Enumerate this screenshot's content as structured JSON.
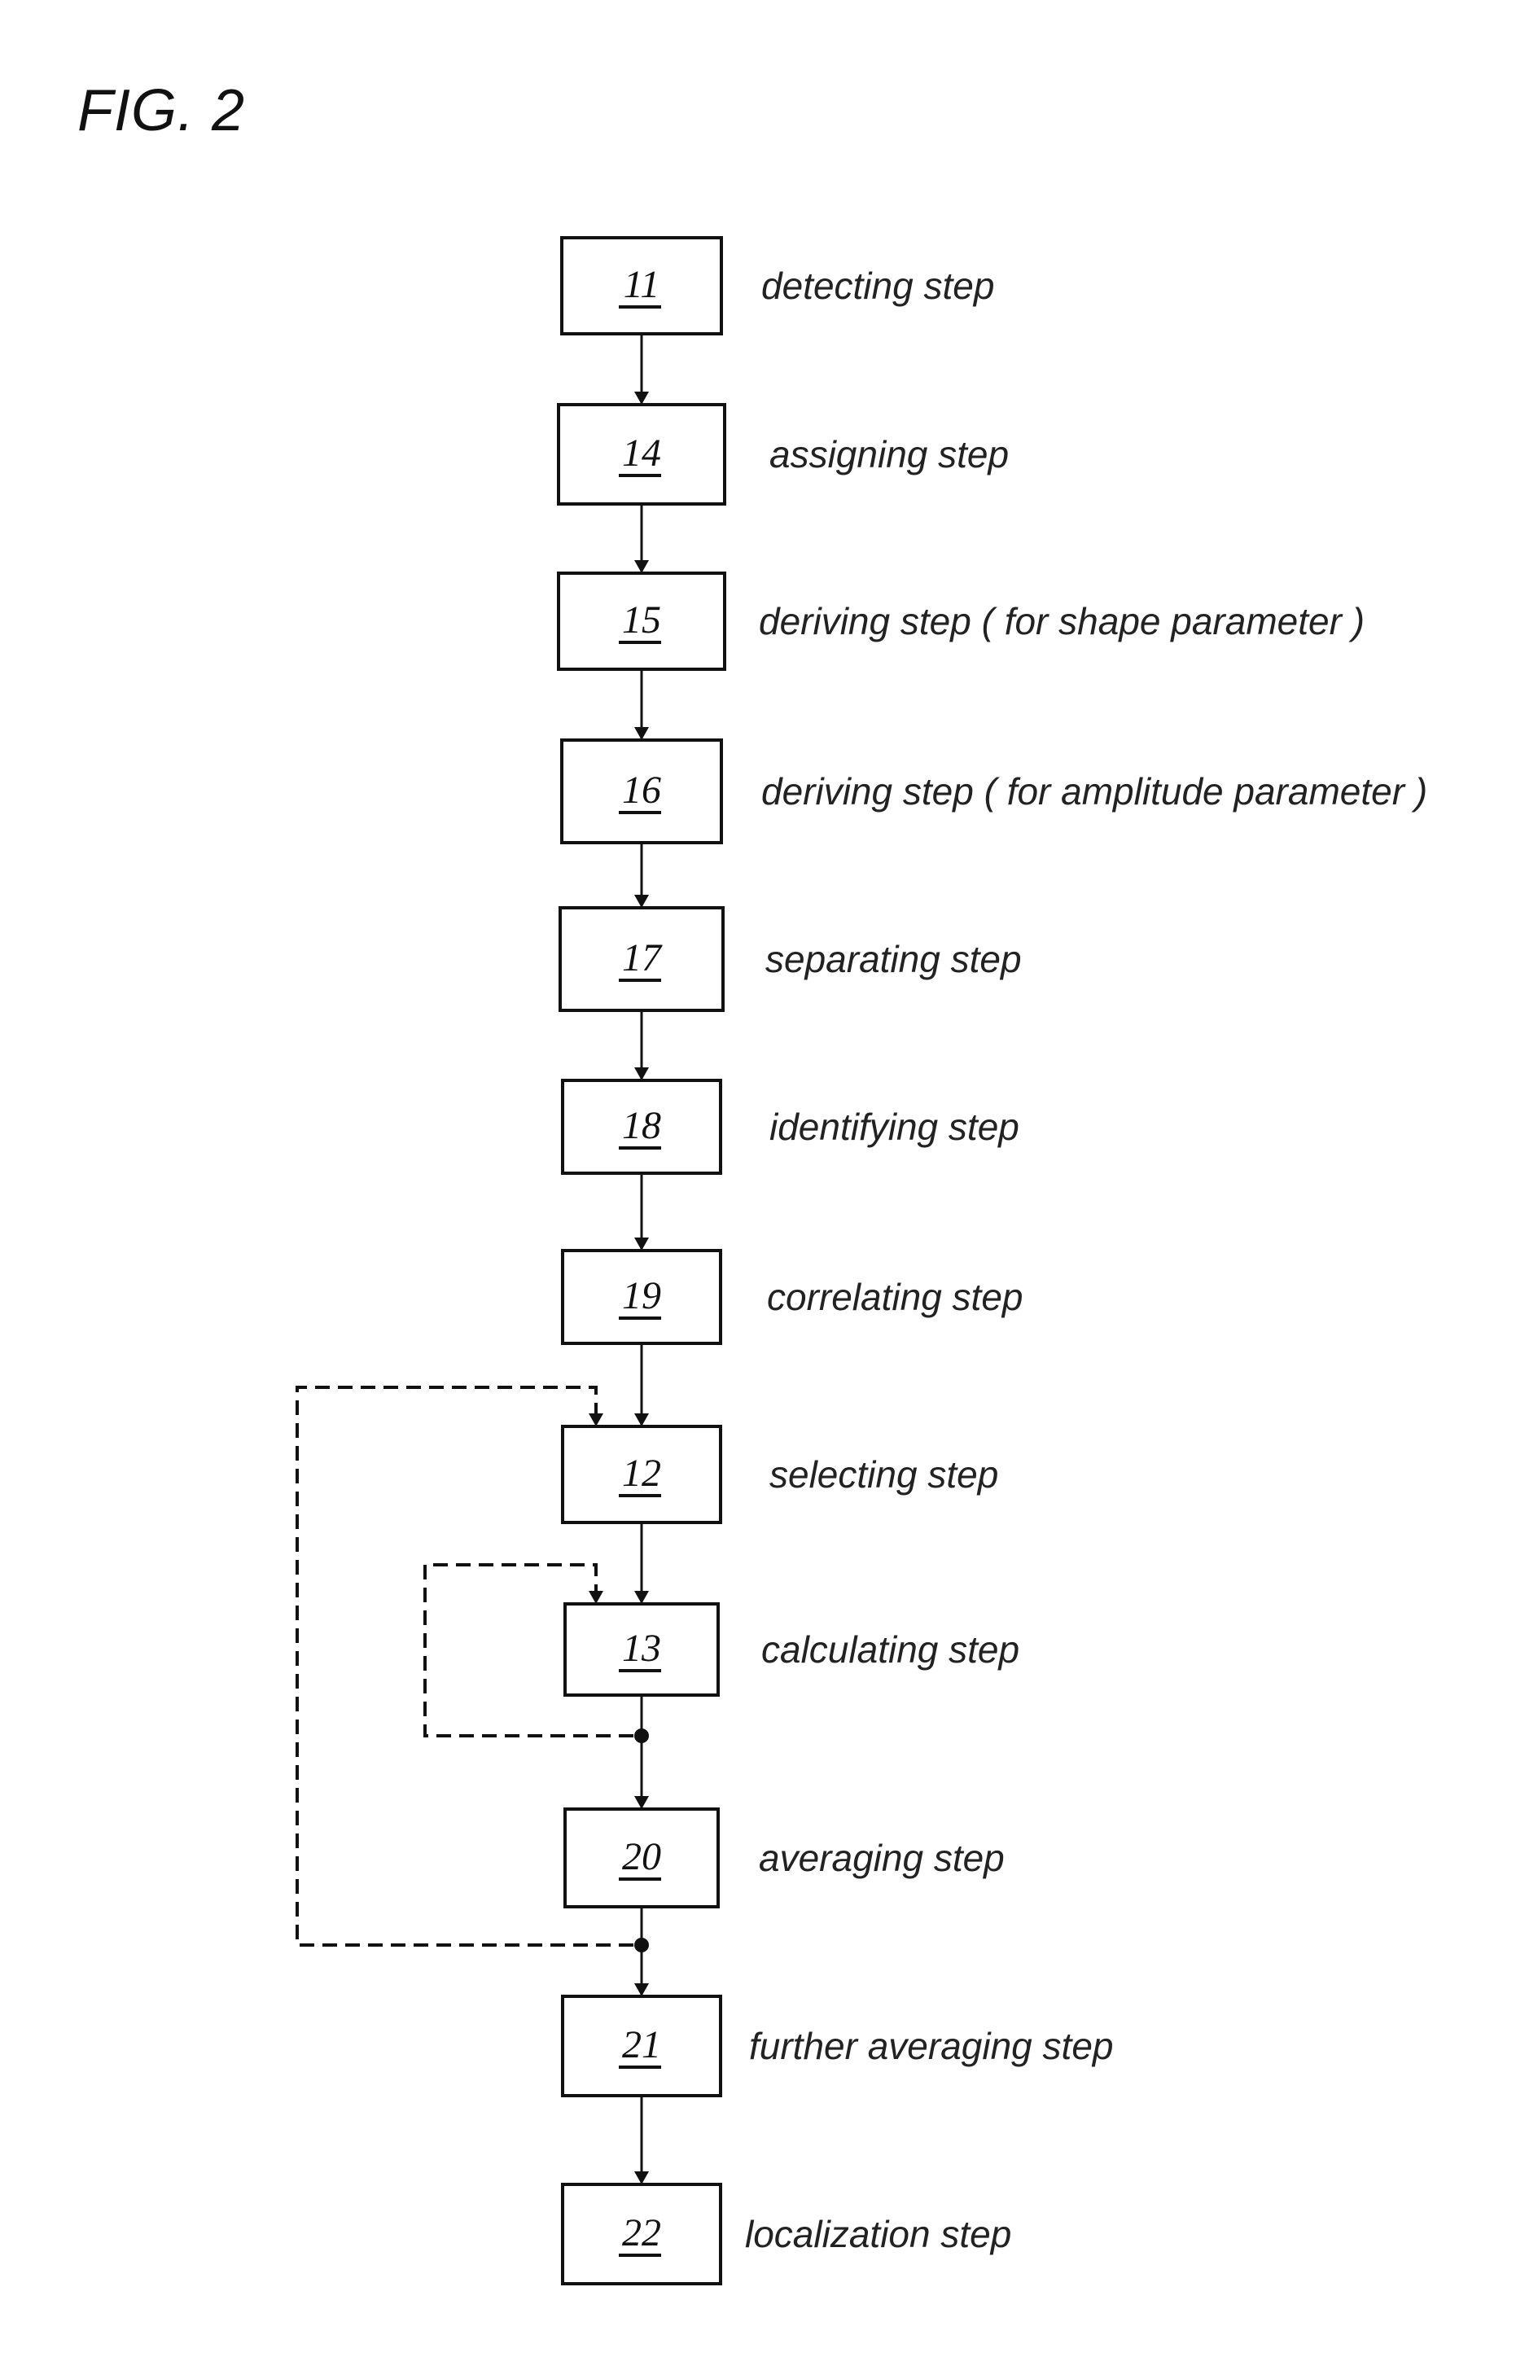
{
  "figure": {
    "title": "FIG. 2"
  },
  "steps": [
    {
      "id": "11",
      "label": "detecting step"
    },
    {
      "id": "14",
      "label": "assigning step"
    },
    {
      "id": "15",
      "label": "deriving step ( for shape parameter )"
    },
    {
      "id": "16",
      "label": "deriving step ( for amplitude parameter )"
    },
    {
      "id": "17",
      "label": "separating step"
    },
    {
      "id": "18",
      "label": "identifying step"
    },
    {
      "id": "19",
      "label": "correlating step"
    },
    {
      "id": "12",
      "label": "selecting step"
    },
    {
      "id": "13",
      "label": "calculating step"
    },
    {
      "id": "20",
      "label": "averaging step"
    },
    {
      "id": "21",
      "label": "further averaging step"
    },
    {
      "id": "22",
      "label": "localization step"
    }
  ],
  "flow": [
    {
      "from": "11",
      "to": "14",
      "style": "solid"
    },
    {
      "from": "14",
      "to": "15",
      "style": "solid"
    },
    {
      "from": "15",
      "to": "16",
      "style": "solid"
    },
    {
      "from": "16",
      "to": "17",
      "style": "solid"
    },
    {
      "from": "17",
      "to": "18",
      "style": "solid"
    },
    {
      "from": "18",
      "to": "19",
      "style": "solid"
    },
    {
      "from": "19",
      "to": "12",
      "style": "solid"
    },
    {
      "from": "12",
      "to": "13",
      "style": "solid"
    },
    {
      "from": "13",
      "to": "20",
      "style": "solid"
    },
    {
      "from": "20",
      "to": "21",
      "style": "solid"
    },
    {
      "from": "21",
      "to": "22",
      "style": "solid"
    }
  ],
  "loops": [
    {
      "from_after": "13",
      "to": "13",
      "style": "dashed",
      "name": "inner-loop"
    },
    {
      "from_after": "20",
      "to": "12",
      "style": "dashed",
      "name": "outer-loop"
    }
  ]
}
